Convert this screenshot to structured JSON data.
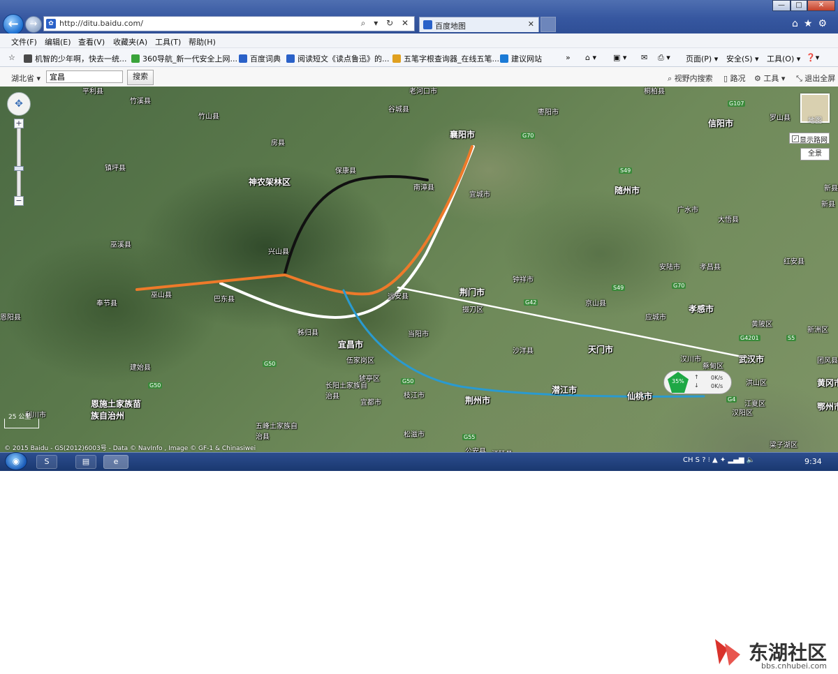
{
  "browser": {
    "address": "http://ditu.baidu.com/",
    "tab_title": "百度地图",
    "address_controls": "⌕ ▾ ↻ ✕",
    "menu": [
      "文件(F)",
      "编辑(E)",
      "查看(V)",
      "收藏夹(A)",
      "工具(T)",
      "帮助(H)"
    ],
    "favorites": [
      {
        "label": "机智的少年啊，快去一统...",
        "color": "#4a4a4a"
      },
      {
        "label": "360导航_新一代安全上网...",
        "color": "#3aa33a"
      },
      {
        "label": "百度词典",
        "color": "#2a61c8"
      },
      {
        "label": "阅读短文《读点鲁迅》的...",
        "color": "#2a61c8"
      },
      {
        "label": "五笔字根查询器_在线五笔...",
        "color": "#e0a020"
      },
      {
        "label": "建议网站",
        "color": "#1a7ad6"
      }
    ],
    "more": "»",
    "commands": [
      "页面(P) ▾",
      "安全(S) ▾",
      "工具(O) ▾"
    ],
    "window_buttons": {
      "min": "—",
      "max": "□",
      "close": "✕"
    },
    "top_icons": "⌂★⚙"
  },
  "mapbar": {
    "province": "湖北省 ▾",
    "city_value": "宜昌",
    "search_label": "搜索",
    "tools": [
      "视野内搜索",
      "路况",
      "工具",
      "退出全屏"
    ]
  },
  "map": {
    "places": [
      {
        "name": "平利县",
        "big": false
      },
      {
        "name": "竹溪县",
        "big": false
      },
      {
        "name": "竹山县",
        "big": false
      },
      {
        "name": "房县",
        "big": false
      },
      {
        "name": "镇坪县",
        "big": false
      },
      {
        "name": "保康县",
        "big": false
      },
      {
        "name": "神农架林区",
        "big": true
      },
      {
        "name": "南漳县",
        "big": false
      },
      {
        "name": "谷城县",
        "big": false
      },
      {
        "name": "老河口市",
        "big": false
      },
      {
        "name": "襄阳市",
        "big": true
      },
      {
        "name": "枣阳市",
        "big": false
      },
      {
        "name": "桐柏县",
        "big": false
      },
      {
        "name": "信阳市",
        "big": true
      },
      {
        "name": "罗山县",
        "big": false
      },
      {
        "name": "宜城市",
        "big": false
      },
      {
        "name": "随州市",
        "big": true
      },
      {
        "name": "广水市",
        "big": false
      },
      {
        "name": "大悟县",
        "big": false
      },
      {
        "name": "新县",
        "big": false
      },
      {
        "name": "巫溪县",
        "big": false
      },
      {
        "name": "兴山县",
        "big": false
      },
      {
        "name": "巫山县",
        "big": false
      },
      {
        "name": "奉节县",
        "big": false
      },
      {
        "name": "巴东县",
        "big": false
      },
      {
        "name": "远安县",
        "big": false
      },
      {
        "name": "荆门市",
        "big": true
      },
      {
        "name": "钟祥市",
        "big": false
      },
      {
        "name": "掇刀区",
        "big": false
      },
      {
        "name": "京山县",
        "big": false
      },
      {
        "name": "安陆市",
        "big": false
      },
      {
        "name": "孝昌县",
        "big": false
      },
      {
        "name": "红安县",
        "big": false
      },
      {
        "name": "孝感市",
        "big": true
      },
      {
        "name": "应城市",
        "big": false
      },
      {
        "name": "黄陂区",
        "big": false
      },
      {
        "name": "新洲区",
        "big": false
      },
      {
        "name": "秭归县",
        "big": false
      },
      {
        "name": "当阳市",
        "big": false
      },
      {
        "name": "宜昌市",
        "big": true
      },
      {
        "name": "天门市",
        "big": true
      },
      {
        "name": "沙洋县",
        "big": false
      },
      {
        "name": "汉川市",
        "big": false
      },
      {
        "name": "武汉市",
        "big": true
      },
      {
        "name": "团风县",
        "big": false
      },
      {
        "name": "建始县",
        "big": false
      },
      {
        "name": "伍家岗区",
        "big": false
      },
      {
        "name": "猇亭区",
        "big": false
      },
      {
        "name": "长阳土家族自治县",
        "big": false
      },
      {
        "name": "宜都市",
        "big": false
      },
      {
        "name": "枝江市",
        "big": false
      },
      {
        "name": "荆州市",
        "big": true
      },
      {
        "name": "潜江市",
        "big": true
      },
      {
        "name": "仙桃市",
        "big": true
      },
      {
        "name": "蔡甸区",
        "big": false
      },
      {
        "name": "洪山区",
        "big": false
      },
      {
        "name": "汉阳区",
        "big": false
      },
      {
        "name": "江夏区",
        "big": false
      },
      {
        "name": "黄冈市",
        "big": true
      },
      {
        "name": "鄂州市",
        "big": true
      },
      {
        "name": "恩施土家族苗族自治州",
        "big": true
      },
      {
        "name": "利川市",
        "big": false
      },
      {
        "name": "五峰土家族自治县",
        "big": false
      },
      {
        "name": "松滋市",
        "big": false
      },
      {
        "name": "公安县",
        "big": false
      },
      {
        "name": "江陵县",
        "big": false
      },
      {
        "name": "梁子湖区",
        "big": false
      },
      {
        "name": "恩阳县",
        "big": false
      },
      {
        "name": "新县",
        "big": false
      }
    ],
    "highways": [
      "G70",
      "G107",
      "S49",
      "S49",
      "G70",
      "G42",
      "G50",
      "G50",
      "G50",
      "G55",
      "G4201",
      "G4",
      "S5"
    ],
    "zoom_plus": "+",
    "zoom_minus": "−",
    "nav_icon": "✥",
    "map_type_label": "地图",
    "roadnet_label": "显示路网",
    "roadnet_checked": "✓",
    "fullview_label": "全景",
    "scale_label": "25 公里",
    "copyright": "© 2015 Baidu - GS(2012)6003号 - Data © NavInfo , Image © GF-1 & Chinasiwei",
    "speed": {
      "percent": "35%",
      "up": "0K/s",
      "down": "0K/s"
    },
    "routes": [
      {
        "color": "#111111"
      },
      {
        "color": "#ffffff"
      },
      {
        "color": "#ee7a2a"
      },
      {
        "color": "#2a9ad0"
      }
    ]
  },
  "taskbar": {
    "start": "◉",
    "tray": "CH  S  ?  ⁝  ▲  ✦  ▂▄▆  🔈",
    "clock": "9:34"
  },
  "watermark": {
    "brand": "东湖社区",
    "site": "bbs.cnhubei.com",
    "accent": "#d9322b"
  }
}
